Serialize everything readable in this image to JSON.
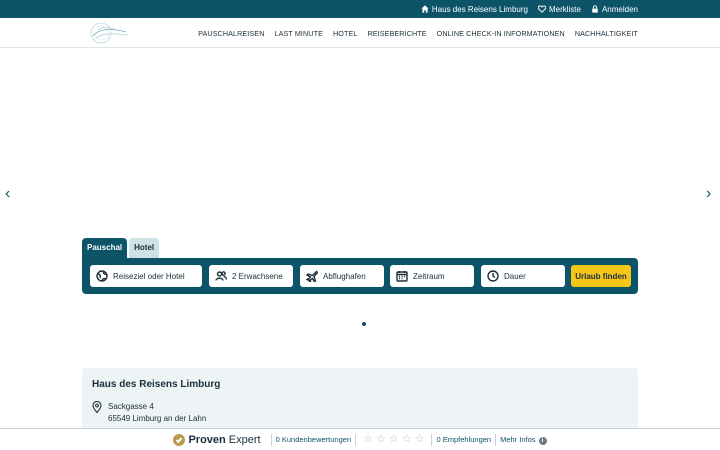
{
  "topbar": {
    "shop_label": "Haus des Reisens Limburg",
    "wishlist_label": "Merkliste",
    "login_label": "Anmelden"
  },
  "nav": {
    "items": [
      "PAUSCHALREISEN",
      "LAST MINUTE",
      "HOTEL",
      "REISEBERICHTE",
      "ONLINE CHECK-IN INFORMATIONEN",
      "NACHHALTIGKEIT"
    ]
  },
  "hero": {
    "prev_arrow": "‹",
    "next_arrow": "›"
  },
  "search": {
    "tabs": [
      {
        "label": "Pauschal",
        "active": true
      },
      {
        "label": "Hotel",
        "active": false
      }
    ],
    "destination_label": "Reiseziel oder Hotel",
    "travellers_label": "2 Erwachsene",
    "airport_label": "Abflughafen",
    "period_label": "Zeitraum",
    "duration_label": "Dauer",
    "submit_label": "Urlaub finden",
    "colors": {
      "bar": "#0e5468",
      "button": "#f5c518"
    }
  },
  "card": {
    "title": "Haus des Reisens Limburg",
    "street": "Sackgasse 4",
    "city": "65549  Limburg an der Lahn"
  },
  "proven_expert": {
    "brand_bold": "Proven",
    "brand_light": " Expert",
    "reviews_label": "0 Kundenbewertungen",
    "rating_stars": 0,
    "star_glyph": "☆",
    "recommendations_label": "0 Empfehlungen",
    "more_info_label": "Mehr Infos",
    "info_glyph": "i"
  }
}
